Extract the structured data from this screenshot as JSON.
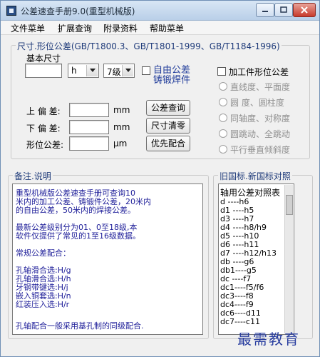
{
  "window": {
    "title": "公差速查手册9.0(重型机械版)"
  },
  "menu": [
    "文件菜单",
    "扩展查询",
    "附录资料",
    "帮助菜单"
  ],
  "tolerance_group": {
    "title": "尺寸.形位公差(GB/T1800.3、GB/T1801-1999、GB/T1184-1996)",
    "basic_size_label": "基本尺寸",
    "basic_size_value": "",
    "hole_shaft_select": "h",
    "grade_select": "7级",
    "free_tolerance_label_1": "自由公差",
    "free_tolerance_label_2": "铸锻焊件",
    "upper_dev_label": "上 偏 差:",
    "upper_dev_value": "",
    "upper_unit": "mm",
    "lower_dev_label": "下 偏 差:",
    "lower_dev_value": "",
    "lower_unit": "mm",
    "form_tol_label": "形位公差:",
    "form_tol_value": "",
    "form_unit": "μm",
    "query_button": "公差查询",
    "clear_button": "尺寸清零",
    "prefer_button": "优先配合",
    "form_checkbox_label": "加工件形位公差",
    "radio_options": [
      "直线度、平面度",
      "圆   度、圆柱度",
      "同轴度、对称度",
      "圆跳动、全跳动",
      "平行垂直倾斜度"
    ]
  },
  "notes_group": {
    "title": "备注.说明",
    "lines": [
      "    重型机械版公差速查手册可查询10",
      "米内的加工公差、铸锻件公差，20米内",
      "的自由公差，50米内的焊接公差。",
      "",
      "    最新公差级别分为01、0至18级,本",
      "软件仅提供了常见的1至16级数据。",
      "",
      "    常规公差配合：",
      "",
      "   孔轴滑合选:H/g",
      "   孔轴滑合选:H/h",
      "   牙钢带键选:H/j",
      "   嵌入铜套选:H/n",
      "   红装压入选:H/r",
      "",
      " 孔轴配合一般采用基孔制的同级配合."
    ]
  },
  "standards_group": {
    "title": "旧国标.新国标对照",
    "lines": [
      "轴用公差对照表",
      "d    ----h6",
      "d1  ----h5",
      "d3  ----h7",
      "d4  ----h8/h9",
      "d5  ----h10",
      "d6  ----h11",
      "d7  ----h12/h13",
      "db  ----g6",
      "db1----g5",
      "dc  ----f7",
      "dc1----f5/f6",
      "dc3----f8",
      "dc4----f9",
      "dc6----d11",
      "dc7----c11"
    ]
  },
  "watermark": "最需教育"
}
